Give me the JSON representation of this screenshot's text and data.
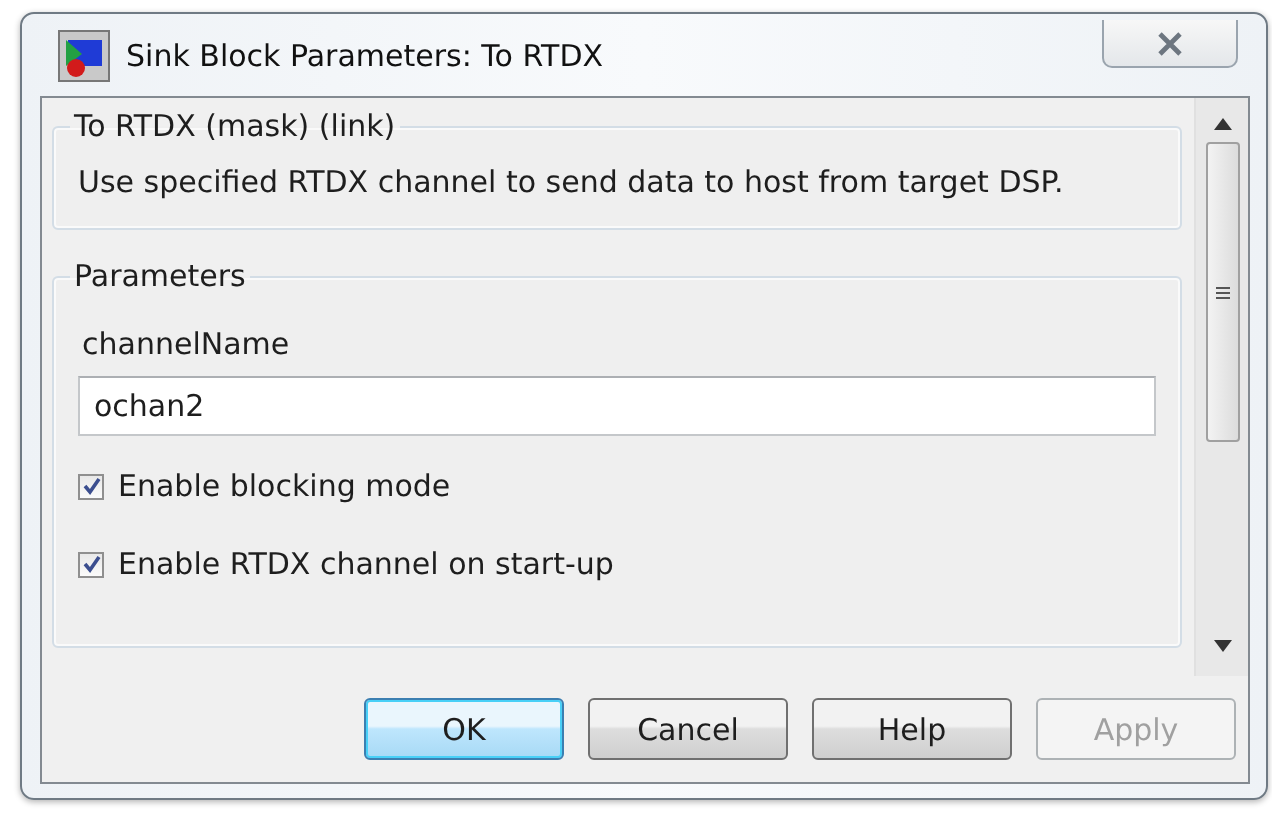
{
  "window": {
    "title": "Sink Block Parameters: To RTDX"
  },
  "description_group": {
    "title": "To RTDX (mask) (link)",
    "text": "Use specified RTDX channel to send data to host from target DSP."
  },
  "parameters_group": {
    "title": "Parameters",
    "fields": [
      {
        "label": "channelName",
        "value": "ochan2"
      }
    ],
    "checkboxes": [
      {
        "label": "Enable blocking mode",
        "checked": true
      },
      {
        "label": "Enable RTDX channel on start-up",
        "checked": true
      }
    ]
  },
  "buttons": [
    {
      "label": "OK",
      "default": true,
      "disabled": false
    },
    {
      "label": "Cancel",
      "default": false,
      "disabled": false
    },
    {
      "label": "Help",
      "default": false,
      "disabled": false
    },
    {
      "label": "Apply",
      "default": false,
      "disabled": true
    }
  ]
}
